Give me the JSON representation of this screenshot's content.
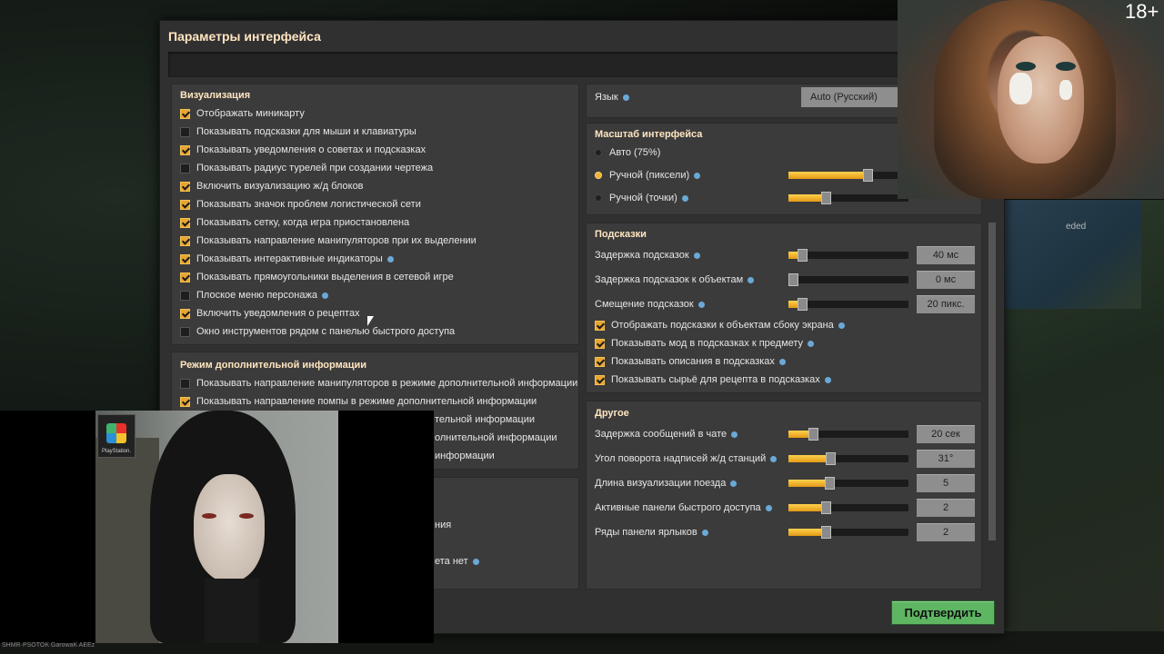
{
  "dialog": {
    "title": "Параметры интерфейса",
    "confirm_label": "Подтвердить"
  },
  "visualization": {
    "heading": "Визуализация",
    "items": [
      {
        "label": "Отображать миникарту",
        "checked": true
      },
      {
        "label": "Показывать подсказки для мыши и клавиатуры",
        "checked": false
      },
      {
        "label": "Показывать уведомления о советах и подсказках",
        "checked": true
      },
      {
        "label": "Показывать радиус турелей при создании чертежа",
        "checked": false
      },
      {
        "label": "Включить визуализацию ж/д блоков",
        "checked": true
      },
      {
        "label": "Показывать значок проблем логистической сети",
        "checked": true
      },
      {
        "label": "Показывать сетку, когда игра приостановлена",
        "checked": true
      },
      {
        "label": "Показывать направление манипуляторов при их выделении",
        "checked": true
      },
      {
        "label": "Показывать интерактивные индикаторы",
        "checked": true,
        "info": true
      },
      {
        "label": "Показывать прямоугольники выделения в сетевой игре",
        "checked": true
      },
      {
        "label": "Плоское меню персонажа",
        "checked": false,
        "info": true
      },
      {
        "label": "Включить уведомления о рецептах",
        "checked": true
      },
      {
        "label": "Окно инструментов рядом с панелью быстрого доступа",
        "checked": false
      }
    ]
  },
  "alt_mode": {
    "heading": "Режим дополнительной информации",
    "items": [
      {
        "label": "Показывать направление манипуляторов в режиме дополнительной информации",
        "checked": false
      },
      {
        "label": "Показывать направление помпы в режиме дополнительной информации",
        "checked": true
      },
      {
        "label": "тельной информации"
      },
      {
        "label": "олнительной информации"
      },
      {
        "label": "информации"
      }
    ],
    "partial_1": "ния",
    "partial_2": "ета нет"
  },
  "language": {
    "label": "Язык",
    "value": "Auto (Русский)"
  },
  "scale": {
    "heading": "Масштаб интерфейса",
    "options": [
      {
        "label": "Авто (75%)",
        "selected": false
      },
      {
        "label": "Ручной (пиксели)",
        "selected": true,
        "fill": 0.68
      },
      {
        "label": "Ручной (точки)",
        "selected": false,
        "fill": 0.3
      }
    ]
  },
  "tooltips": {
    "heading": "Подсказки",
    "sliders": [
      {
        "label": "Задержка подсказок",
        "value": "40 мс",
        "fill": 0.08
      },
      {
        "label": "Задержка подсказок к объектам",
        "value": "0 мс",
        "fill": 0.0
      },
      {
        "label": "Смещение подсказок",
        "value": "20 пикс.",
        "fill": 0.08
      }
    ],
    "checks": [
      {
        "label": "Отображать подсказки к объектам сбоку экрана",
        "checked": true
      },
      {
        "label": "Показывать мод в подсказках к предмету",
        "checked": true
      },
      {
        "label": "Показывать описания в подсказках",
        "checked": true
      },
      {
        "label": "Показывать сырьё для рецепта в подсказках",
        "checked": true
      }
    ]
  },
  "other": {
    "heading": "Другое",
    "sliders": [
      {
        "label": "Задержка сообщений в чате",
        "value": "20 сек",
        "fill": 0.18
      },
      {
        "label": "Угол поворота надписей ж/д станций",
        "value": "31°",
        "fill": 0.34
      },
      {
        "label": "Длина визуализации поезда",
        "value": "5",
        "fill": 0.33
      },
      {
        "label": "Активные панели быстрого доступа",
        "value": "2",
        "fill": 0.3
      },
      {
        "label": "Ряды панели ярлыков",
        "value": "2",
        "fill": 0.3
      }
    ]
  },
  "overlay": {
    "age_badge": "18+",
    "ps_text": "PlayStation.",
    "map_tag": "eded",
    "caption": "SHMR·PSOTOK GarowaK AEEz"
  }
}
